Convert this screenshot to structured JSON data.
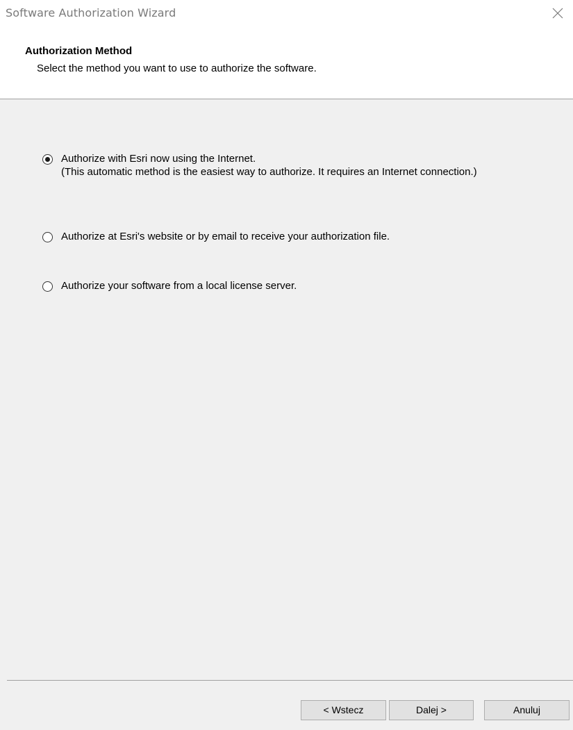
{
  "window": {
    "title": "Software Authorization Wizard",
    "close_icon": "close-icon"
  },
  "header": {
    "title": "Authorization Method",
    "subtitle": "Select the method you want to use to authorize the software."
  },
  "options": [
    {
      "label": "Authorize with Esri now using the Internet.",
      "description": "(This automatic method is the easiest way to authorize. It requires an Internet connection.)",
      "selected": true
    },
    {
      "label": "Authorize at Esri's website or by email to receive your authorization file.",
      "selected": false
    },
    {
      "label": "Authorize your software from a local license server.",
      "selected": false
    }
  ],
  "buttons": {
    "back": "< Wstecz",
    "next": "Dalej >",
    "cancel": "Anuluj"
  }
}
